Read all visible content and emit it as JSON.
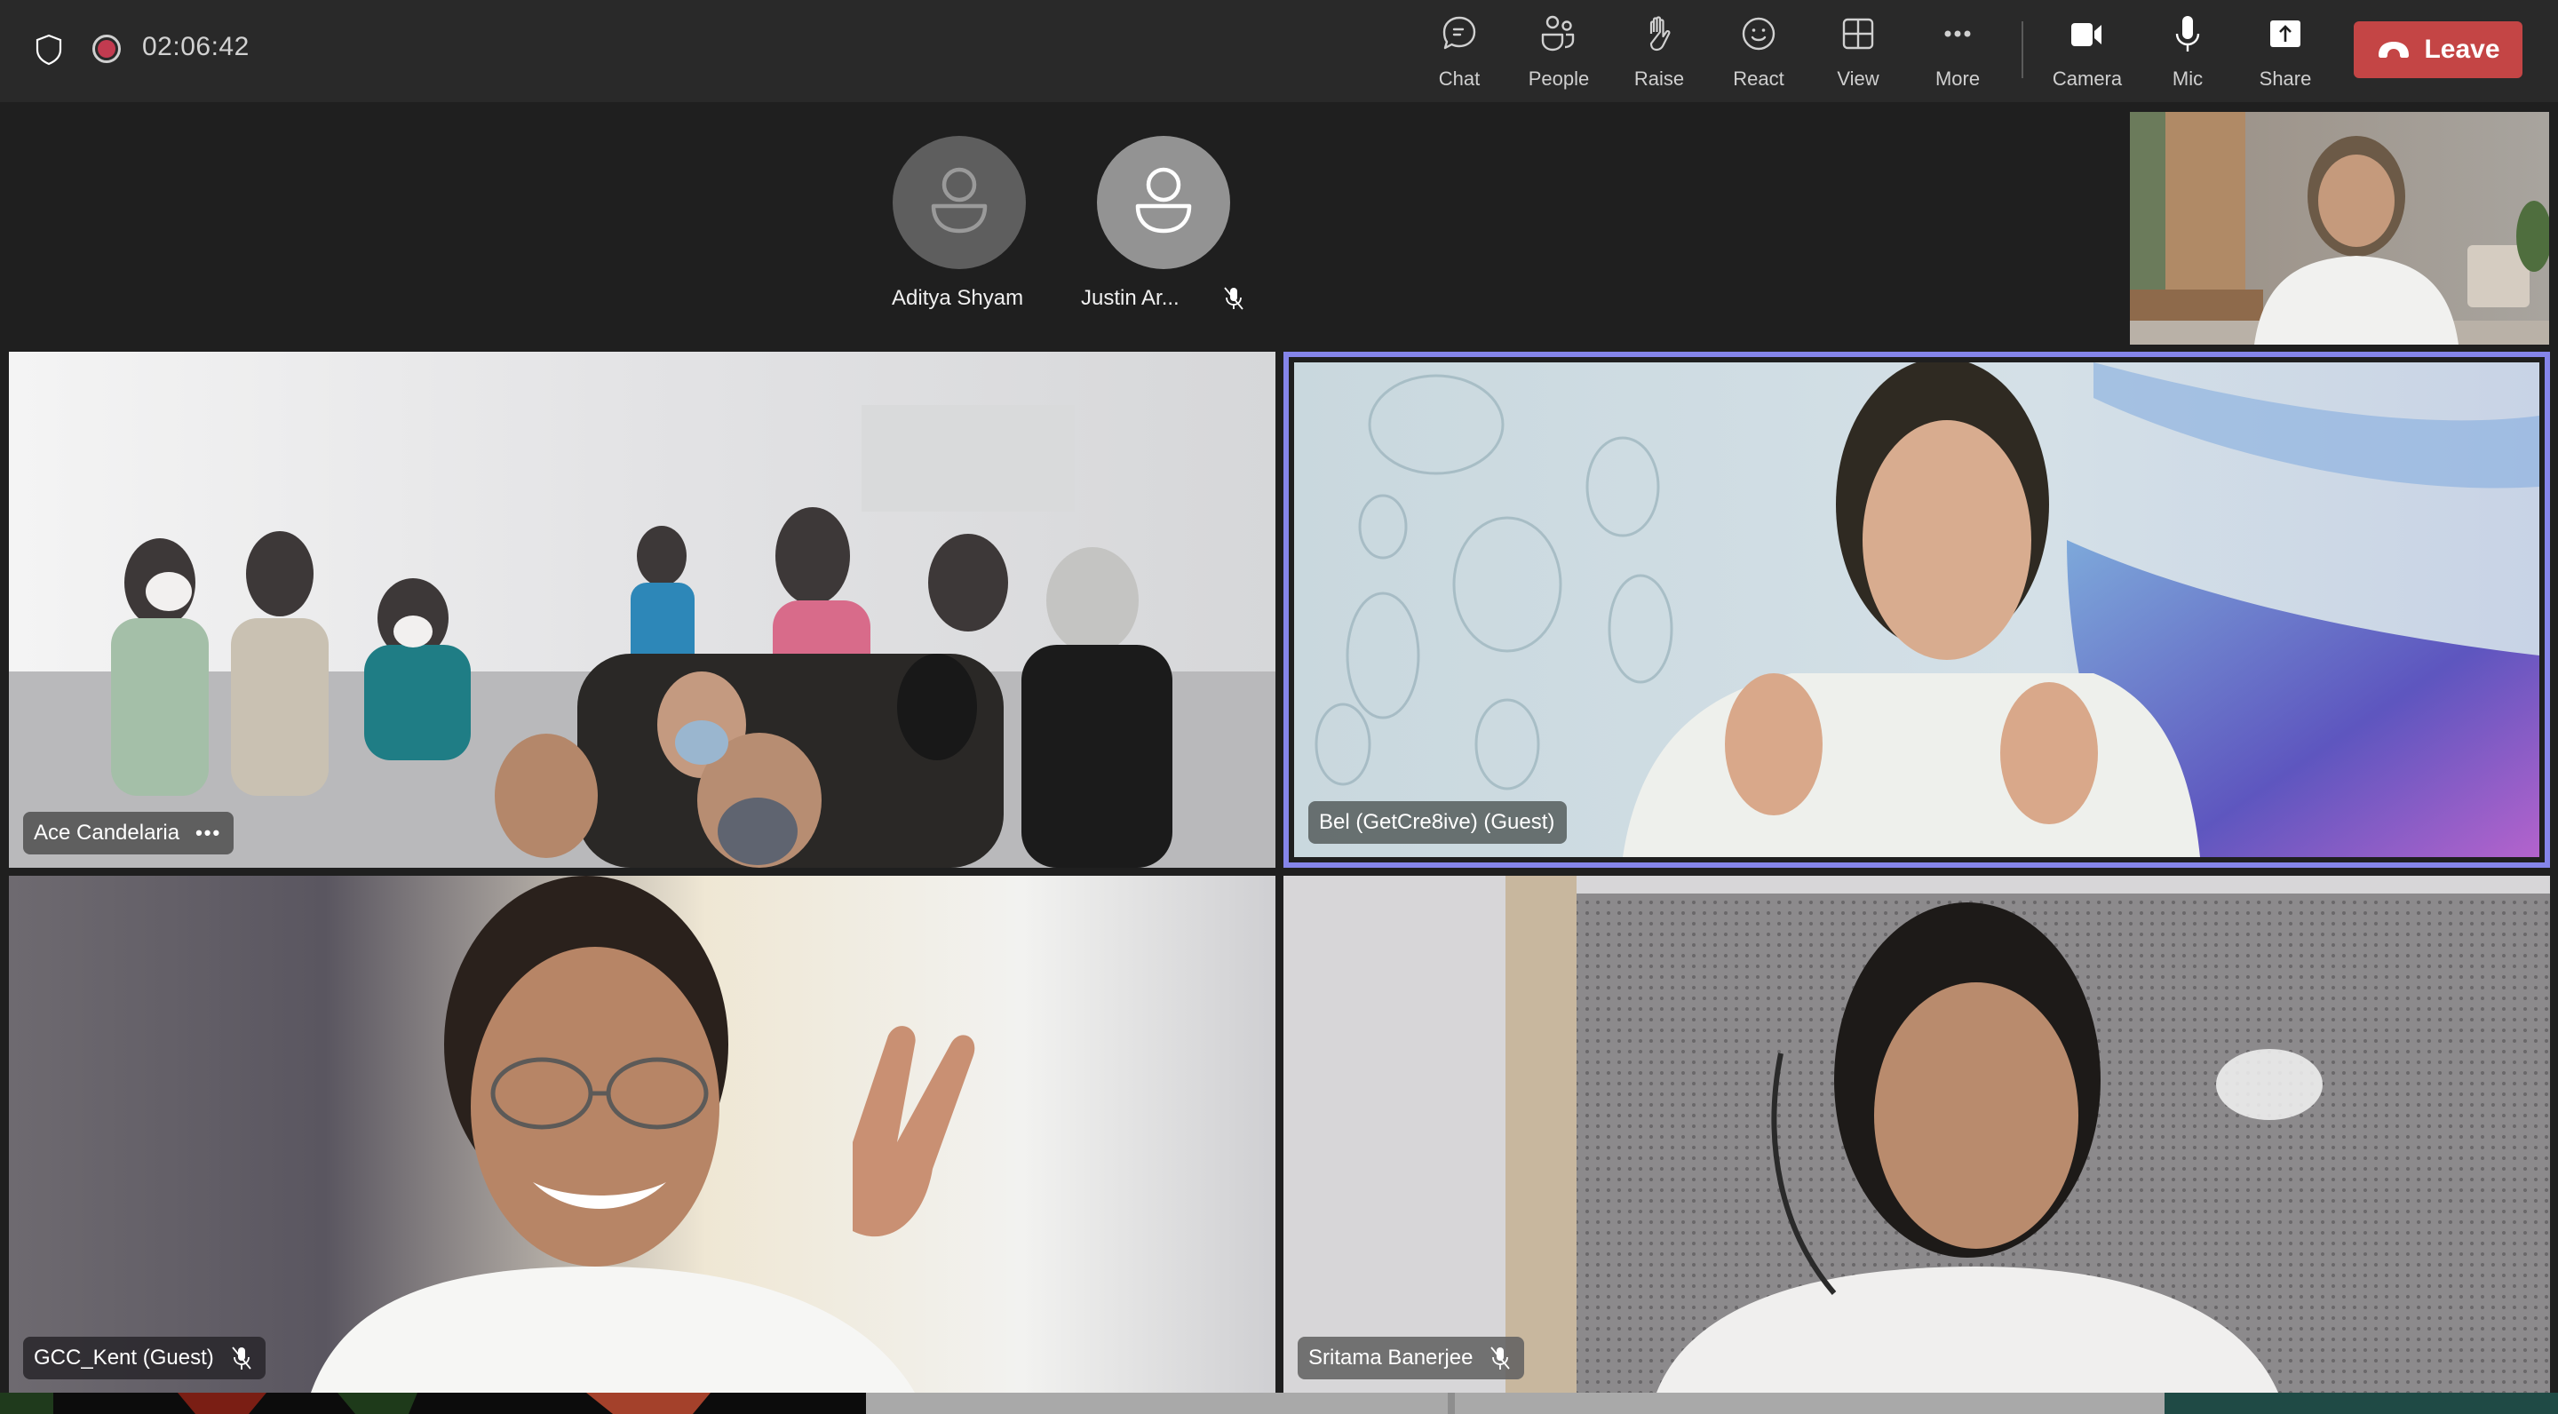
{
  "meeting": {
    "timer": "02:06:42",
    "recording": true,
    "accent_color": "#8585ea",
    "leave_color": "#c44545"
  },
  "toolbar": {
    "buttons": [
      {
        "id": "chat",
        "label": "Chat",
        "icon": "chat-icon"
      },
      {
        "id": "people",
        "label": "People",
        "icon": "people-icon"
      },
      {
        "id": "raise",
        "label": "Raise",
        "icon": "raise-hand-icon"
      },
      {
        "id": "react",
        "label": "React",
        "icon": "smiley-icon"
      },
      {
        "id": "view",
        "label": "View",
        "icon": "grid-view-icon"
      },
      {
        "id": "more",
        "label": "More",
        "icon": "more-dots-icon"
      },
      {
        "id": "camera",
        "label": "Camera",
        "icon": "camera-icon"
      },
      {
        "id": "mic",
        "label": "Mic",
        "icon": "mic-icon"
      },
      {
        "id": "share",
        "label": "Share",
        "icon": "share-icon"
      }
    ],
    "leave_label": "Leave"
  },
  "audio_only_participants": [
    {
      "name": "Aditya Shyam",
      "muted": false
    },
    {
      "name": "Justin Ar...",
      "muted": true
    }
  ],
  "video_tiles": [
    {
      "name": "Ace Candelaria",
      "has_more_menu": true,
      "muted": false,
      "active_speaker": false
    },
    {
      "name": "Bel (GetCre8ive) (Guest)",
      "has_more_menu": false,
      "muted": false,
      "active_speaker": true
    },
    {
      "name": "GCC_Kent (Guest)",
      "has_more_menu": false,
      "muted": true,
      "active_speaker": false
    },
    {
      "name": "Sritama Banerjee",
      "has_more_menu": false,
      "muted": true,
      "active_speaker": false
    }
  ],
  "more_menu_glyph": "•••"
}
